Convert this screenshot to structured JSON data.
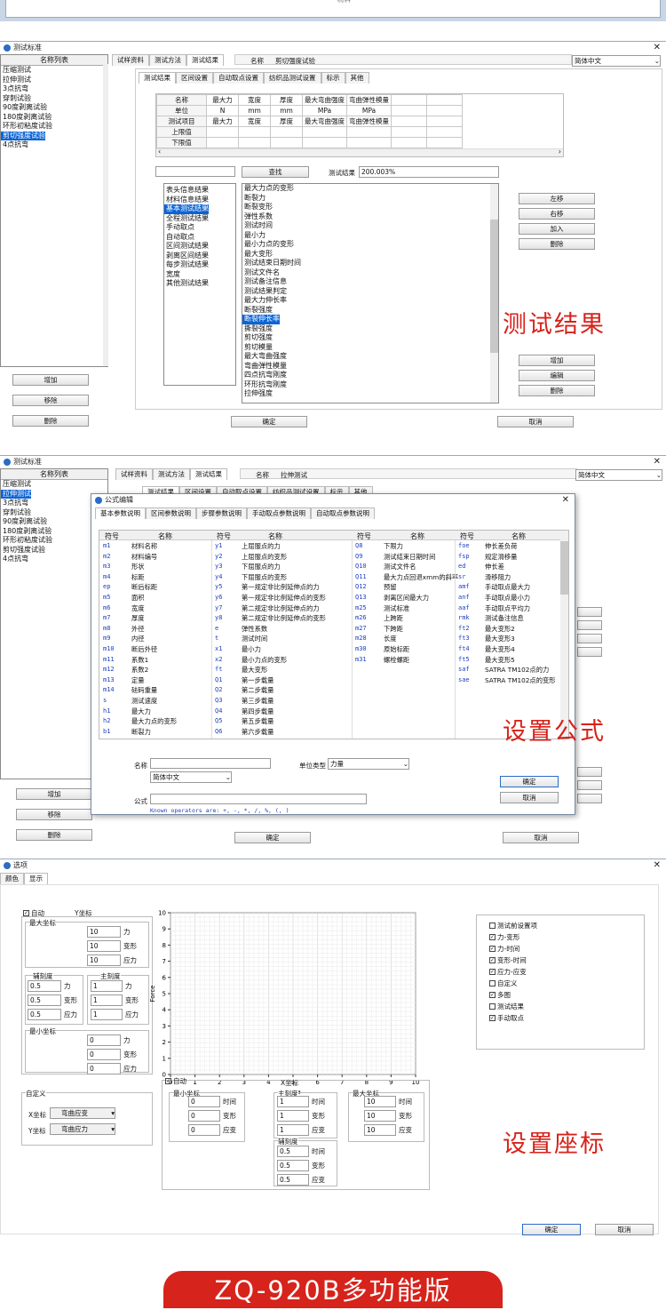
{
  "top_strip": {
    "text": "材料"
  },
  "s1": {
    "title": "测试标准",
    "list_header": "名称列表",
    "items": [
      "压缩测试",
      "拉伸测试",
      "3点抗弯",
      "穿刺试验",
      "90度剥离试验",
      "180度剥离试验",
      "环形初粘度试验",
      "剪切强度试验",
      "4点抗弯"
    ],
    "selected": 7,
    "left_buttons": [
      "增加",
      "移除",
      "删除"
    ],
    "tabs": [
      "试样资料",
      "测试方法",
      "测试结果"
    ],
    "name_label": "名称",
    "name_value": "剪切强度试验",
    "lang": "简体中文",
    "subtabs": [
      "测试结果",
      "区间设置",
      "自动取点设置",
      "纺织品测试设置",
      "标示",
      "其他"
    ],
    "grid_rows": [
      [
        "名称",
        "最大力",
        "宽度",
        "厚度",
        "最大弯曲强度",
        "弯曲弹性模量"
      ],
      [
        "单位",
        "N",
        "mm",
        "mm",
        "MPa",
        "MPa"
      ],
      [
        "测试项目",
        "最大力",
        "宽度",
        "厚度",
        "最大弯曲强度",
        "弯曲弹性模量"
      ],
      [
        "上限值",
        "",
        "",
        "",
        "",
        ""
      ],
      [
        "下限值",
        "",
        "",
        "",
        "",
        ""
      ]
    ],
    "find_button": "查找",
    "result_label": "测试结果",
    "result_value": "200.003%",
    "categories": [
      "表头信息结果",
      "材料信息结果",
      "基本测试结果",
      "全程测试结果",
      "手动取点",
      "自动取点",
      "区间测试结果",
      "剥离区间结果",
      "每步测试结果",
      "宽度",
      "其他测试结果"
    ],
    "cat_selected": 2,
    "results": [
      "最大力点的变形",
      "断裂力",
      "断裂变形",
      "弹性系数",
      "测试时间",
      "最小力",
      "最小力点的变形",
      "最大变形",
      "测试结束日期时间",
      "测试文件名",
      "测试备注信息",
      "测试结果判定",
      "最大力伸长率",
      "断裂强度",
      "断裂伸长率",
      "撕裂强度",
      "剪切强度",
      "剪切模量",
      "最大弯曲强度",
      "弯曲弹性模量",
      "四点抗弯刚度",
      "环形抗弯刚度",
      "拉伸强度"
    ],
    "res_selected": 14,
    "right_buttons1": [
      "左移",
      "右移",
      "加入",
      "删除"
    ],
    "right_buttons2": [
      "增加",
      "编辑",
      "删除"
    ],
    "ok": "确定",
    "cancel": "取消",
    "caption": "测试结果"
  },
  "s2": {
    "title": "测试标准",
    "list_header": "名称列表",
    "items": [
      "压缩测试",
      "拉伸测试",
      "3点抗弯",
      "穿刺试验",
      "90度剥离试验",
      "180度剥离试验",
      "环形初粘度试验",
      "剪切强度试验",
      "4点抗弯"
    ],
    "selected": 1,
    "left_buttons": [
      "增加",
      "移除",
      "删除"
    ],
    "tabs": [
      "试样资料",
      "测试方法",
      "测试结果"
    ],
    "name_label": "名称",
    "name_value": "拉伸测试",
    "lang": "简体中文",
    "subtabs": [
      "测试结果",
      "区间设置",
      "自动取点设置",
      "纺织品测试设置",
      "标示",
      "其他"
    ],
    "ok": "确定",
    "cancel": "取消",
    "dlg": {
      "title": "公式编辑",
      "tabs": [
        "基本参数说明",
        "区间参数说明",
        "步骤参数说明",
        "手动取点参数说明",
        "自动取点参数说明"
      ],
      "headers": [
        "符号",
        "名称",
        "符号",
        "名称",
        "符号",
        "名称",
        "符号",
        "名称"
      ],
      "col1": [
        [
          "m1",
          "材料名称"
        ],
        [
          "m2",
          "材料编号"
        ],
        [
          "m3",
          "形状"
        ],
        [
          "m4",
          "标距"
        ],
        [
          "ep",
          "断后标距"
        ],
        [
          "m5",
          "面积"
        ],
        [
          "m6",
          "宽度"
        ],
        [
          "m7",
          "厚度"
        ],
        [
          "m8",
          "外径"
        ],
        [
          "m9",
          "内径"
        ],
        [
          "m10",
          "断后外径"
        ],
        [
          "m11",
          "系数1"
        ],
        [
          "m12",
          "系数2"
        ],
        [
          "m13",
          "定量"
        ],
        [
          "m14",
          "砝码重量"
        ],
        [
          "s",
          "测试速度"
        ],
        [
          "h1",
          "最大力"
        ],
        [
          "h2",
          "最大力点的变形"
        ],
        [
          "b1",
          "断裂力"
        ]
      ],
      "col2": [
        [
          "y1",
          "上屈服点的力"
        ],
        [
          "y2",
          "上屈服点的变形"
        ],
        [
          "y3",
          "下屈服点的力"
        ],
        [
          "y4",
          "下屈服点的变形"
        ],
        [
          "y5",
          "第一规定非比例延伸点的力"
        ],
        [
          "y6",
          "第一规定非比例延伸点的变形"
        ],
        [
          "y7",
          "第二规定非比例延伸点的力"
        ],
        [
          "y8",
          "第二规定非比例延伸点的变形"
        ],
        [
          "e",
          "弹性系数"
        ],
        [
          "t",
          "测试时间"
        ],
        [
          "x1",
          "最小力"
        ],
        [
          "x2",
          "最小力点的变形"
        ],
        [
          "ft",
          "最大变形"
        ],
        [
          "Q1",
          "第一步载量"
        ],
        [
          "Q2",
          "第二步载量"
        ],
        [
          "Q3",
          "第三步载量"
        ],
        [
          "Q4",
          "第四步载量"
        ],
        [
          "Q5",
          "第五步载量"
        ],
        [
          "Q6",
          "第六步载量"
        ]
      ],
      "col3": [
        [
          "Q8",
          "下限力"
        ],
        [
          "Q9",
          "测试结束日期时间"
        ],
        [
          "Q10",
          "测试文件名"
        ],
        [
          "Q11",
          "最大力点回退xmm的斜率"
        ],
        [
          "Q12",
          "预留"
        ],
        [
          "Q13",
          "剥离区间最大力"
        ],
        [
          "m25",
          "测试标准"
        ],
        [
          "m26",
          "上跨距"
        ],
        [
          "m27",
          "下跨距"
        ],
        [
          "m28",
          "长度"
        ],
        [
          "m30",
          "原始标距"
        ],
        [
          "m31",
          "螺栓螺距"
        ]
      ],
      "col4": [
        [
          "foe",
          "伸长差负荷"
        ],
        [
          "fsp",
          "规定滑移量"
        ],
        [
          "ed",
          "伸长差"
        ],
        [
          "sr",
          "滑移阻力"
        ],
        [
          "amf",
          "手动取点最大力"
        ],
        [
          "anf",
          "手动取点最小力"
        ],
        [
          "aaf",
          "手动取点平均力"
        ],
        [
          "rmk",
          "测试备注信息"
        ],
        [
          "ft2",
          "最大变形2"
        ],
        [
          "ft3",
          "最大变形3"
        ],
        [
          "ft4",
          "最大变形4"
        ],
        [
          "ft5",
          "最大变形5"
        ],
        [
          "saf",
          "SATRA TM102点的力"
        ],
        [
          "sae",
          "SATRA TM102点的变形"
        ]
      ],
      "name_label": "名称",
      "lang": "简体中文",
      "unit_label": "单位类型",
      "unit_value": "力量",
      "formula_label": "公式",
      "operators": "Known operators are: +, -, *, /, %, (, )",
      "ok": "确定",
      "cancel": "取消"
    },
    "caption": "设置公式"
  },
  "s3": {
    "title": "选项",
    "tabs": [
      "颜色",
      "显示"
    ],
    "auto": "自动",
    "ylabel_y": "Y坐标",
    "max_legend": "最大坐标",
    "max_vals": [
      "10",
      "10",
      "10"
    ],
    "units_y": [
      "力",
      "变形",
      "应力"
    ],
    "aux_legend": "辅刻度",
    "aux_vals": [
      "0.5",
      "0.5",
      "0.5"
    ],
    "main_legend": "主刻度",
    "main_vals": [
      "1",
      "1",
      "1"
    ],
    "min_legend": "最小坐标",
    "min_vals": [
      "0",
      "0",
      "0"
    ],
    "custom_legend": "自定义",
    "x_label": "X坐标",
    "x_value": "弯曲应变",
    "y_label": "Y坐标",
    "y_value": "弯曲应力",
    "chart_y_title": "Force",
    "chart_x_title": "Time",
    "x_auto": "自动",
    "x_coord": "X坐标",
    "x_min_legend": "最小坐标",
    "x_min_vals": [
      "0",
      "0",
      "0"
    ],
    "x_main_legend": "主刻度",
    "x_main_vals": [
      "1",
      "1",
      "1"
    ],
    "x_aux_legend": "辅刻度",
    "x_aux_vals": [
      "0.5",
      "0.5",
      "0.5"
    ],
    "x_max_legend": "最大坐标",
    "x_max_vals": [
      "10",
      "10",
      "10"
    ],
    "units_x": [
      "时间",
      "变形",
      "应变"
    ],
    "checks": [
      [
        "测试前设置项",
        false
      ],
      [
        "力-变形",
        true
      ],
      [
        "力-时间",
        true
      ],
      [
        "变形-时间",
        true
      ],
      [
        "应力-应变",
        true
      ],
      [
        "自定义",
        false
      ],
      [
        "多图",
        true
      ],
      [
        "测试结果",
        false
      ],
      [
        "手动取点",
        true
      ]
    ],
    "ok": "确定",
    "cancel": "取消",
    "caption": "设置座标"
  },
  "footer": "ZQ-920B多功能版",
  "chart_data": {
    "type": "line",
    "x": [],
    "y": [],
    "xlabel": "Time",
    "ylabel": "Force",
    "xlim": [
      0,
      10
    ],
    "ylim": [
      0,
      10
    ],
    "grid": true,
    "xticks": [
      "0",
      "1",
      "2",
      "3",
      "4",
      "5",
      "6",
      "7",
      "8",
      "9",
      "10"
    ],
    "yticks": [
      "0",
      "1",
      "2",
      "3",
      "4",
      "5",
      "6",
      "7",
      "8",
      "9",
      "10"
    ]
  },
  "colors": {
    "accent": "#0a64d6",
    "caption": "#d6231b",
    "footer_bg": "#d6231b"
  }
}
